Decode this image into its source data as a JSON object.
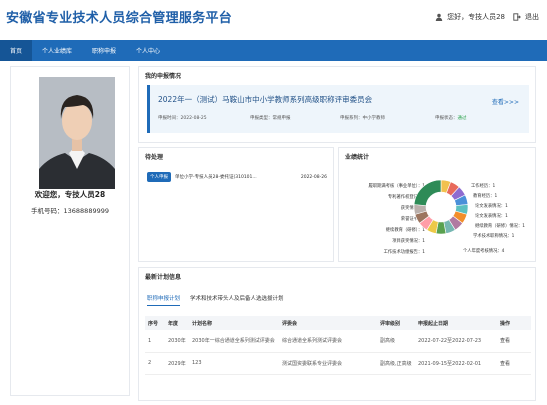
{
  "header": {
    "title": "安徽省专业技术人员综合管理服务平台",
    "greeting": "您好，专技人员28",
    "logout": "退出"
  },
  "nav": {
    "items": [
      {
        "label": "首页"
      },
      {
        "label": "个人业绩库"
      },
      {
        "label": "职称申报"
      },
      {
        "label": "个人中心"
      }
    ]
  },
  "profile": {
    "welcome": "欢迎您，专技人员28",
    "phone_label": "手机号码：",
    "phone": "13688889999"
  },
  "my_app": {
    "heading": "我的申报情况",
    "title": "2022年一（测试）马鞍山市中小学教师系列高级职称评审委员会",
    "view": "查看>>>",
    "meta": [
      {
        "label": "申报时间：",
        "value": "2022-08-25"
      },
      {
        "label": "申报类型：",
        "value": "常规申报"
      },
      {
        "label": "申报系列：",
        "value": "中小学教师"
      },
      {
        "label": "申报状态：",
        "value": "通过"
      }
    ]
  },
  "todo": {
    "heading": "待处理",
    "items": [
      {
        "tag": "个人申报",
        "text": "单位小学-专技人员28-委托证(310101...",
        "date": "2022-08-26"
      }
    ]
  },
  "stats": {
    "heading": "业绩统计",
    "left_labels": [
      "履职期满考核（事业单位）：1",
      "专利著作权登记：1",
      "获奖情况：1",
      "荣誉证书：1",
      "继续教育（研修）：1",
      "项目获奖情况：1",
      "工作技术功绩报告：1"
    ],
    "right_labels": [
      "工作经历：1",
      "教育经历：1",
      "论文发表情况：1",
      "论文发表情况：1",
      "继续教育（研修）情况：1",
      "学术技术职称情况：1",
      "个人年度考核情况：4"
    ]
  },
  "plan": {
    "heading": "最新计划信息",
    "tabs": [
      "职称申报计划",
      "学术和技术带头人及后备人选选拔计划"
    ],
    "columns": [
      "序号",
      "年度",
      "计划名称",
      "评委会",
      "评审级别",
      "申报起止日期",
      "操作"
    ],
    "rows": [
      {
        "no": "1",
        "year": "2030年",
        "name": "2030年一综合通道全系列测试评委会",
        "board": "综合通道全系列测试评委会",
        "level": "副高级",
        "dates": "2022-07-22至2022-07-23",
        "op": "查看"
      },
      {
        "no": "2",
        "year": "2029年",
        "name": "123",
        "board": "测试国资委联系专业评委会",
        "level": "副高级,正高级",
        "dates": "2021-09-15至2022-02-01",
        "op": "查看"
      }
    ]
  },
  "colors": {
    "primary": "#1f6bb8",
    "title": "#1f5fa8",
    "ok": "#2aa24a"
  },
  "chart_data": {
    "type": "pie",
    "categories": [
      "履职期满考核（事业单位）",
      "专利著作权登记",
      "获奖情况",
      "荣誉证书",
      "继续教育（研修）",
      "项目获奖情况",
      "工作技术功绩报告",
      "工作经历",
      "教育经历",
      "论文发表情况",
      "论文发表情况",
      "继续教育（研修）情况",
      "学术技术职称情况",
      "个人年度考核情况"
    ],
    "values": [
      1,
      1,
      1,
      1,
      1,
      1,
      1,
      1,
      1,
      1,
      1,
      1,
      1,
      4
    ],
    "colors": [
      "#f2c14e",
      "#e86a5c",
      "#8e6bd0",
      "#4a90d9",
      "#5cc0c0",
      "#f28e2b",
      "#b07aa1",
      "#76b7b2",
      "#59a14f",
      "#edc948",
      "#ff9da7",
      "#9c755f",
      "#bab0ac",
      "#2e8b57"
    ]
  }
}
